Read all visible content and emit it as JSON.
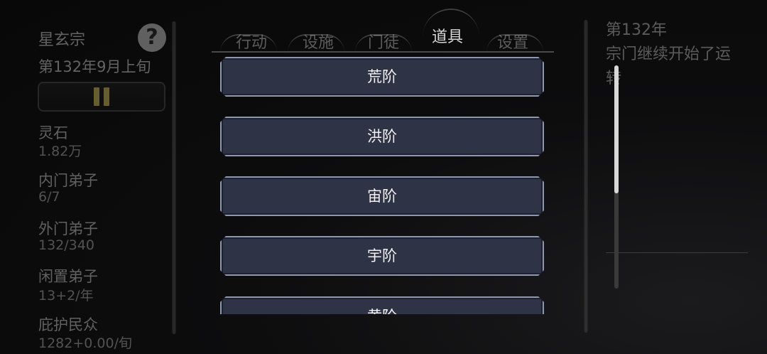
{
  "sidebar": {
    "sect_name": "星玄宗",
    "date": "第132年9月上旬",
    "help_label": "?",
    "stats": [
      {
        "label": "灵石",
        "value": "1.82万"
      },
      {
        "label": "内门弟子",
        "value": "6/7"
      },
      {
        "label": "外门弟子",
        "value": "132/340"
      },
      {
        "label": "闲置弟子",
        "value": "13+2/年"
      },
      {
        "label": "庇护民众",
        "value": "1282+0.00/旬"
      }
    ]
  },
  "tabs": [
    {
      "label": "行动"
    },
    {
      "label": "设施"
    },
    {
      "label": "门徒"
    },
    {
      "label": "道具",
      "active": true
    },
    {
      "label": "设置"
    }
  ],
  "list": {
    "items": [
      {
        "label": "荒阶"
      },
      {
        "label": "洪阶"
      },
      {
        "label": "宙阶"
      },
      {
        "label": "宇阶"
      },
      {
        "label": "黄阶"
      }
    ]
  },
  "log": {
    "year": "第132年",
    "line1": "宗门继续开始了运",
    "line2": "转"
  },
  "colors": {
    "button_fill": "#2e3346",
    "button_border": "#8f97b0",
    "pause_icon": "#d6c45a"
  }
}
